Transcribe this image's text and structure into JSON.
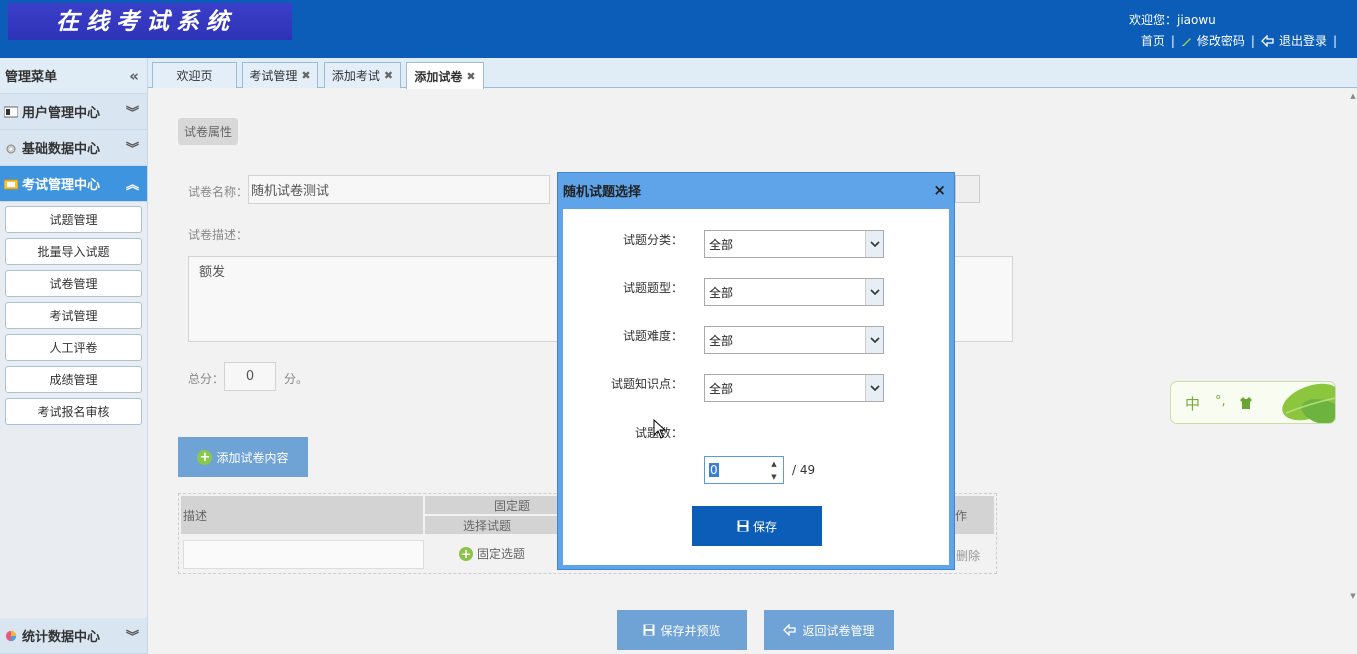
{
  "header": {
    "logo_text": "在线考试系统",
    "welcome": "欢迎您：jiaowu",
    "home": "首页",
    "change_password": "修改密码",
    "logout": "退出登录"
  },
  "sidebar": {
    "title": "管理菜单",
    "categories": [
      {
        "label": "用户管理中心",
        "icon": "user-card-icon"
      },
      {
        "label": "基础数据中心",
        "icon": "gear-icon"
      },
      {
        "label": "考试管理中心",
        "icon": "folder-icon"
      }
    ],
    "exam_items": [
      "试题管理",
      "批量导入试题",
      "试卷管理",
      "考试管理",
      "人工评卷",
      "成绩管理",
      "考试报名审核"
    ],
    "bottom_category": {
      "label": "统计数据中心",
      "icon": "pie-chart-icon"
    }
  },
  "tabs": [
    {
      "label": "欢迎页"
    },
    {
      "label": "考试管理",
      "closable": true
    },
    {
      "label": "添加考试",
      "closable": true
    },
    {
      "label": "添加试卷",
      "closable": true,
      "active": true
    }
  ],
  "form": {
    "section_label": "试卷属性",
    "name_label": "试卷名称：",
    "name_value": "随机试卷测试",
    "desc_label": "试卷描述：",
    "desc_value": "额发",
    "score_label": "总分：",
    "score_value": "0",
    "score_unit": "分。",
    "add_content_button": "添加试卷内容"
  },
  "table": {
    "col_desc": "描述",
    "col_fixed": "固定题",
    "col_select": "选择试题",
    "col_ops_partial": "作",
    "fixed_pick": "固定选题",
    "delete_partial": "删除"
  },
  "bottom_buttons": {
    "save_preview": "保存并预览",
    "back": "返回试卷管理"
  },
  "ime": {
    "chars": [
      "中",
      "°,"
    ]
  },
  "modal": {
    "title": "随机试题选择",
    "close": "×",
    "fields": [
      {
        "label": "试题分类：",
        "value": "全部"
      },
      {
        "label": "试题题型：",
        "value": "全部"
      },
      {
        "label": "试题难度：",
        "value": "全部"
      },
      {
        "label": "试题知识点：",
        "value": "全部"
      }
    ],
    "count_label": "试题数：",
    "count_value": "0",
    "count_total": "/ 49",
    "save_button": "保存"
  },
  "colors": {
    "header_blue": "#0b5db7",
    "accent_blue": "#3e94df",
    "button_blue": "#6fa3d6",
    "modal_frame": "#5fa3e8"
  }
}
